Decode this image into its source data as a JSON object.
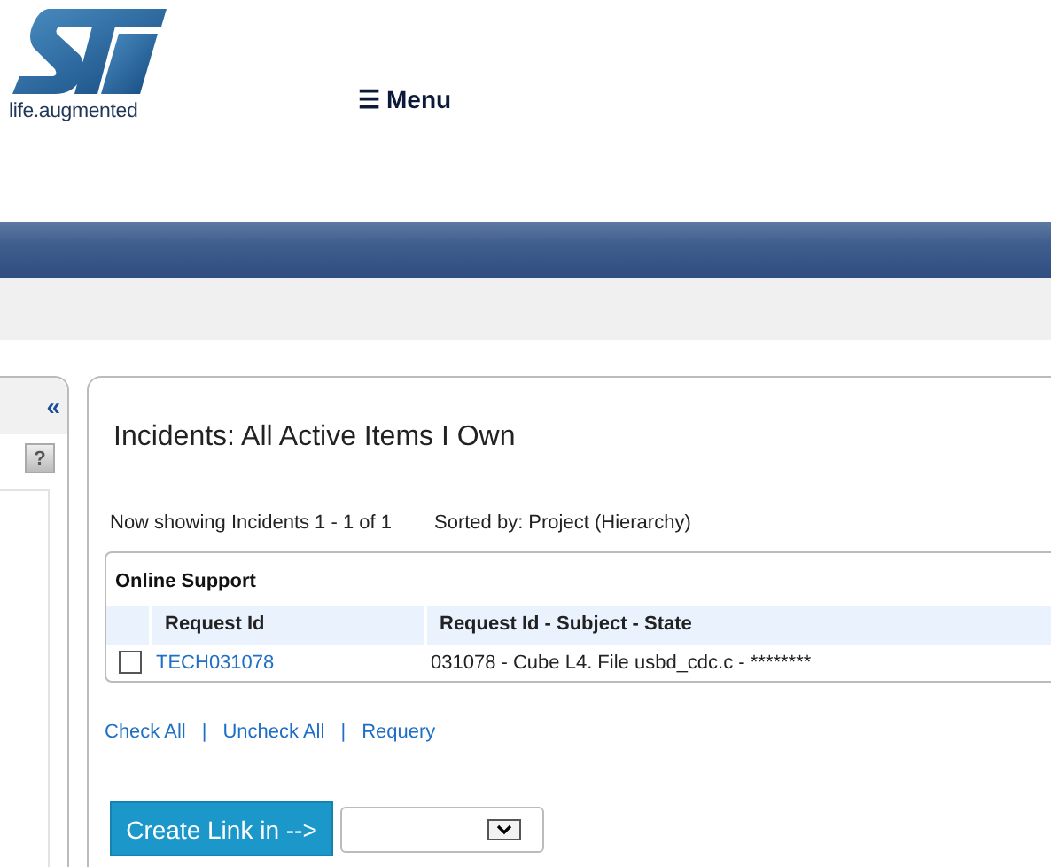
{
  "header": {
    "logo_tagline": "life.augmented",
    "menu": {
      "icon": "☰",
      "label": "Menu"
    }
  },
  "sidebar": {
    "collapse": "«",
    "help": "?"
  },
  "main": {
    "title": "Incidents: All Active Items I Own",
    "showing": "Now showing Incidents 1 - 1 of 1",
    "sorted": "Sorted by: Project (Hierarchy)",
    "table": {
      "title": "Online Support",
      "columns": [
        "Request Id",
        "Request Id - Subject - State"
      ],
      "rows": [
        {
          "checked": false,
          "request_id": "TECH031078",
          "summary": "031078 - Cube L4. File usbd_cdc.c - ********"
        }
      ]
    },
    "links": [
      {
        "label": "Check All"
      },
      {
        "separator": "|",
        "label": "Uncheck All"
      },
      {
        "separator": "|",
        "label": "Requery"
      }
    ],
    "create_button": "Create Link in -->"
  }
}
